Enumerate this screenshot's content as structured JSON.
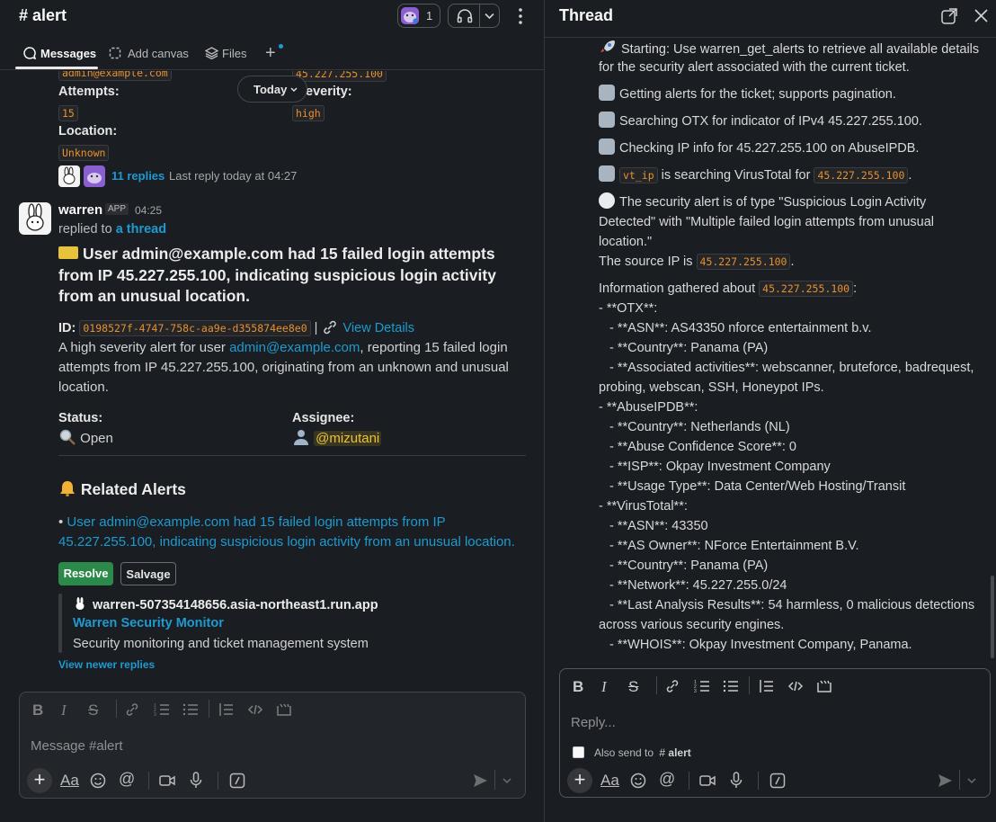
{
  "channel": {
    "title": "# alert",
    "huddle_count": "1"
  },
  "tabs": [
    {
      "label": "Messages"
    },
    {
      "label": "Add canvas"
    },
    {
      "label": "Files"
    }
  ],
  "top_partial": {
    "email_code": "admin@example.com",
    "ip_code": "45.227.255.100",
    "attempts_label": "Attempts:",
    "attempts_value": "15",
    "severity_label_partial": "everity:",
    "severity_value": "high",
    "location_label": "Location:",
    "location_value": "Unknown",
    "replies": "11 replies",
    "last_reply": "Last reply today at 04:27"
  },
  "date_pill": "Today",
  "message": {
    "sender": "warren",
    "badge": "APP",
    "time": "04:25",
    "replied_prefix": "replied to",
    "replied_link": "a thread",
    "headline": "User admin@example.com had 15 failed login attempts from IP 45.227.255.100, indicating suspicious login activity from an unusual location.",
    "id_label": "ID:",
    "id_value": "0198527f-4747-758c-aa9e-d355874ee8e0",
    "id_sep": "|",
    "view_details": "View Details",
    "body_pre": "A high severity alert for user ",
    "body_email": "admin@example.com",
    "body_post": ", reporting 15 failed login attempts from IP 45.227.255.100, originating from an unknown and unusual location.",
    "status_label": "Status:",
    "status_value": "Open",
    "assignee_label": "Assignee:",
    "assignee_value": "@mizutani",
    "related_title": "Related Alerts",
    "related_item": "User admin@example.com had 15 failed login attempts from IP 45.227.255.100, indicating suspicious login activity from an unusual location.",
    "resolve": "Resolve",
    "salvage": "Salvage",
    "unfurl_host": "warren-507354148656.asia-northeast1.run.app",
    "unfurl_title": "Warren Security Monitor",
    "unfurl_desc": "Security monitoring and ticket management system",
    "view_newer": "View newer replies"
  },
  "composer": {
    "placeholder": "Message #alert"
  },
  "thread": {
    "title": "Thread",
    "lines": {
      "l1": "Starting: Use warren_get_alerts to retrieve all available details",
      "l2": "for the security alert associated with the current ticket.",
      "l3": "Getting alerts for the ticket; supports pagination.",
      "l4": "Searching OTX for indicator of IPv4 45.227.255.100.",
      "l5": "Checking IP info for 45.227.255.100 on AbuseIPDB.",
      "l6_code": "vt_ip",
      "l6_mid": " is searching VirusTotal for ",
      "l6_code2": "45.227.255.100",
      "l6_end": ".",
      "l7": "The security alert is of type \"Suspicious Login Activity",
      "l8": "Detected\" with \"Multiple failed login attempts from unusual",
      "l9": "location.\"",
      "l10": "The source IP is ",
      "l10_code": "45.227.255.100",
      "l10_end": ".",
      "l11": "Information gathered about ",
      "l11_code": "45.227.255.100",
      "l11_end": ":",
      "l12": "- **OTX**:",
      "l13": "  - **ASN**: AS43350 nforce entertainment b.v.",
      "l14": "  - **Country**: Panama (PA)",
      "l15": "  - **Associated activities**: webscanner, bruteforce, badrequest,",
      "l16": "probing, webscan, SSH, Honeypot IPs.",
      "l17": "- **AbuseIPDB**:",
      "l18": "  - **Country**: Netherlands (NL)",
      "l19": "  - **Abuse Confidence Score**: 0",
      "l20": "  - **ISP**: Okpay Investment Company",
      "l21": "  - **Usage Type**: Data Center/Web Hosting/Transit",
      "l22": "- **VirusTotal**:",
      "l23": "  - **ASN**: 43350",
      "l24": "  - **AS Owner**: NForce Entertainment B.V.",
      "l25": "  - **Country**: Panama (PA)",
      "l26": "  - **Network**: 45.227.255.0/24",
      "l27": "  - **Last Analysis Results**: 54 harmless, 0 malicious detections",
      "l28": "across various security engines.",
      "l29": "  - **WHOIS**: Okpay Investment Company, Panama."
    },
    "reply_placeholder": "Reply...",
    "also_send": "Also send to",
    "also_send_channel": "alert"
  }
}
